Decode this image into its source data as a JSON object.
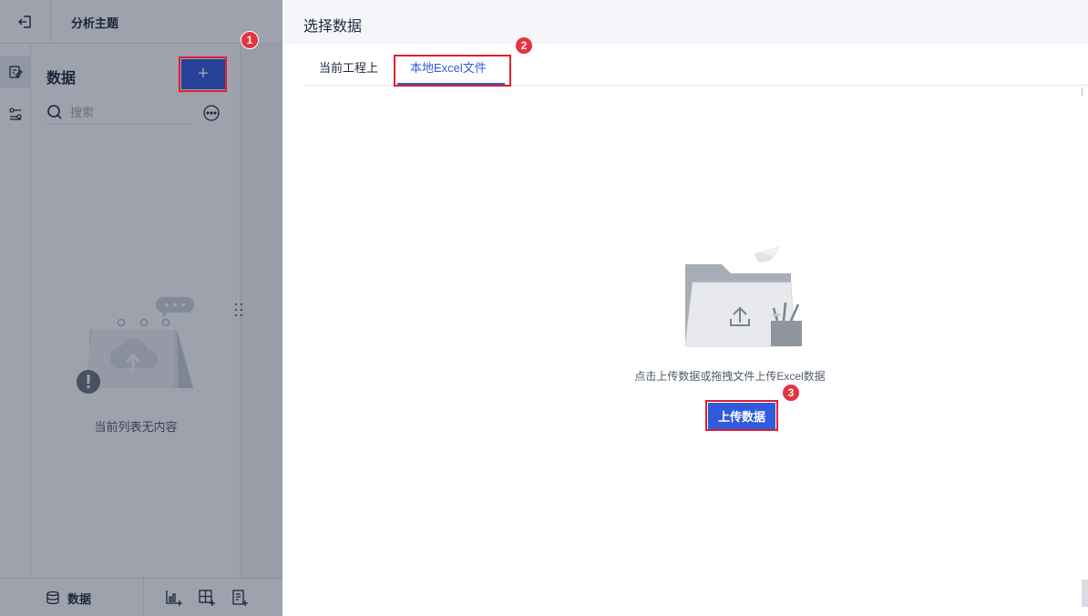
{
  "topbar": {
    "title": "分析主题",
    "exit_icon": "exit-icon"
  },
  "rail": {
    "items": [
      {
        "icon": "edit-doc-icon",
        "active": true
      },
      {
        "icon": "filter-settings-icon",
        "active": false
      }
    ]
  },
  "data_panel": {
    "title": "数据",
    "add_label": "+",
    "search_placeholder": "搜索",
    "empty_text": "当前列表无内容"
  },
  "bottombar": {
    "data_tab_label": "数据",
    "icons": [
      "add-chart-icon",
      "add-table-icon",
      "add-report-icon"
    ]
  },
  "dialog": {
    "title": "选择数据",
    "tabs": [
      {
        "label": "当前工程上",
        "active": false
      },
      {
        "label": "本地Excel文件",
        "active": true
      }
    ],
    "hint": "点击上传数据或拖拽文件上传Excel数据",
    "upload_label": "上传数据"
  },
  "annotations": {
    "step1": "1",
    "step2": "2",
    "step3": "3"
  },
  "colors": {
    "accent": "#2f5bdc",
    "highlight": "#e0202f",
    "badge": "#e5333f"
  }
}
